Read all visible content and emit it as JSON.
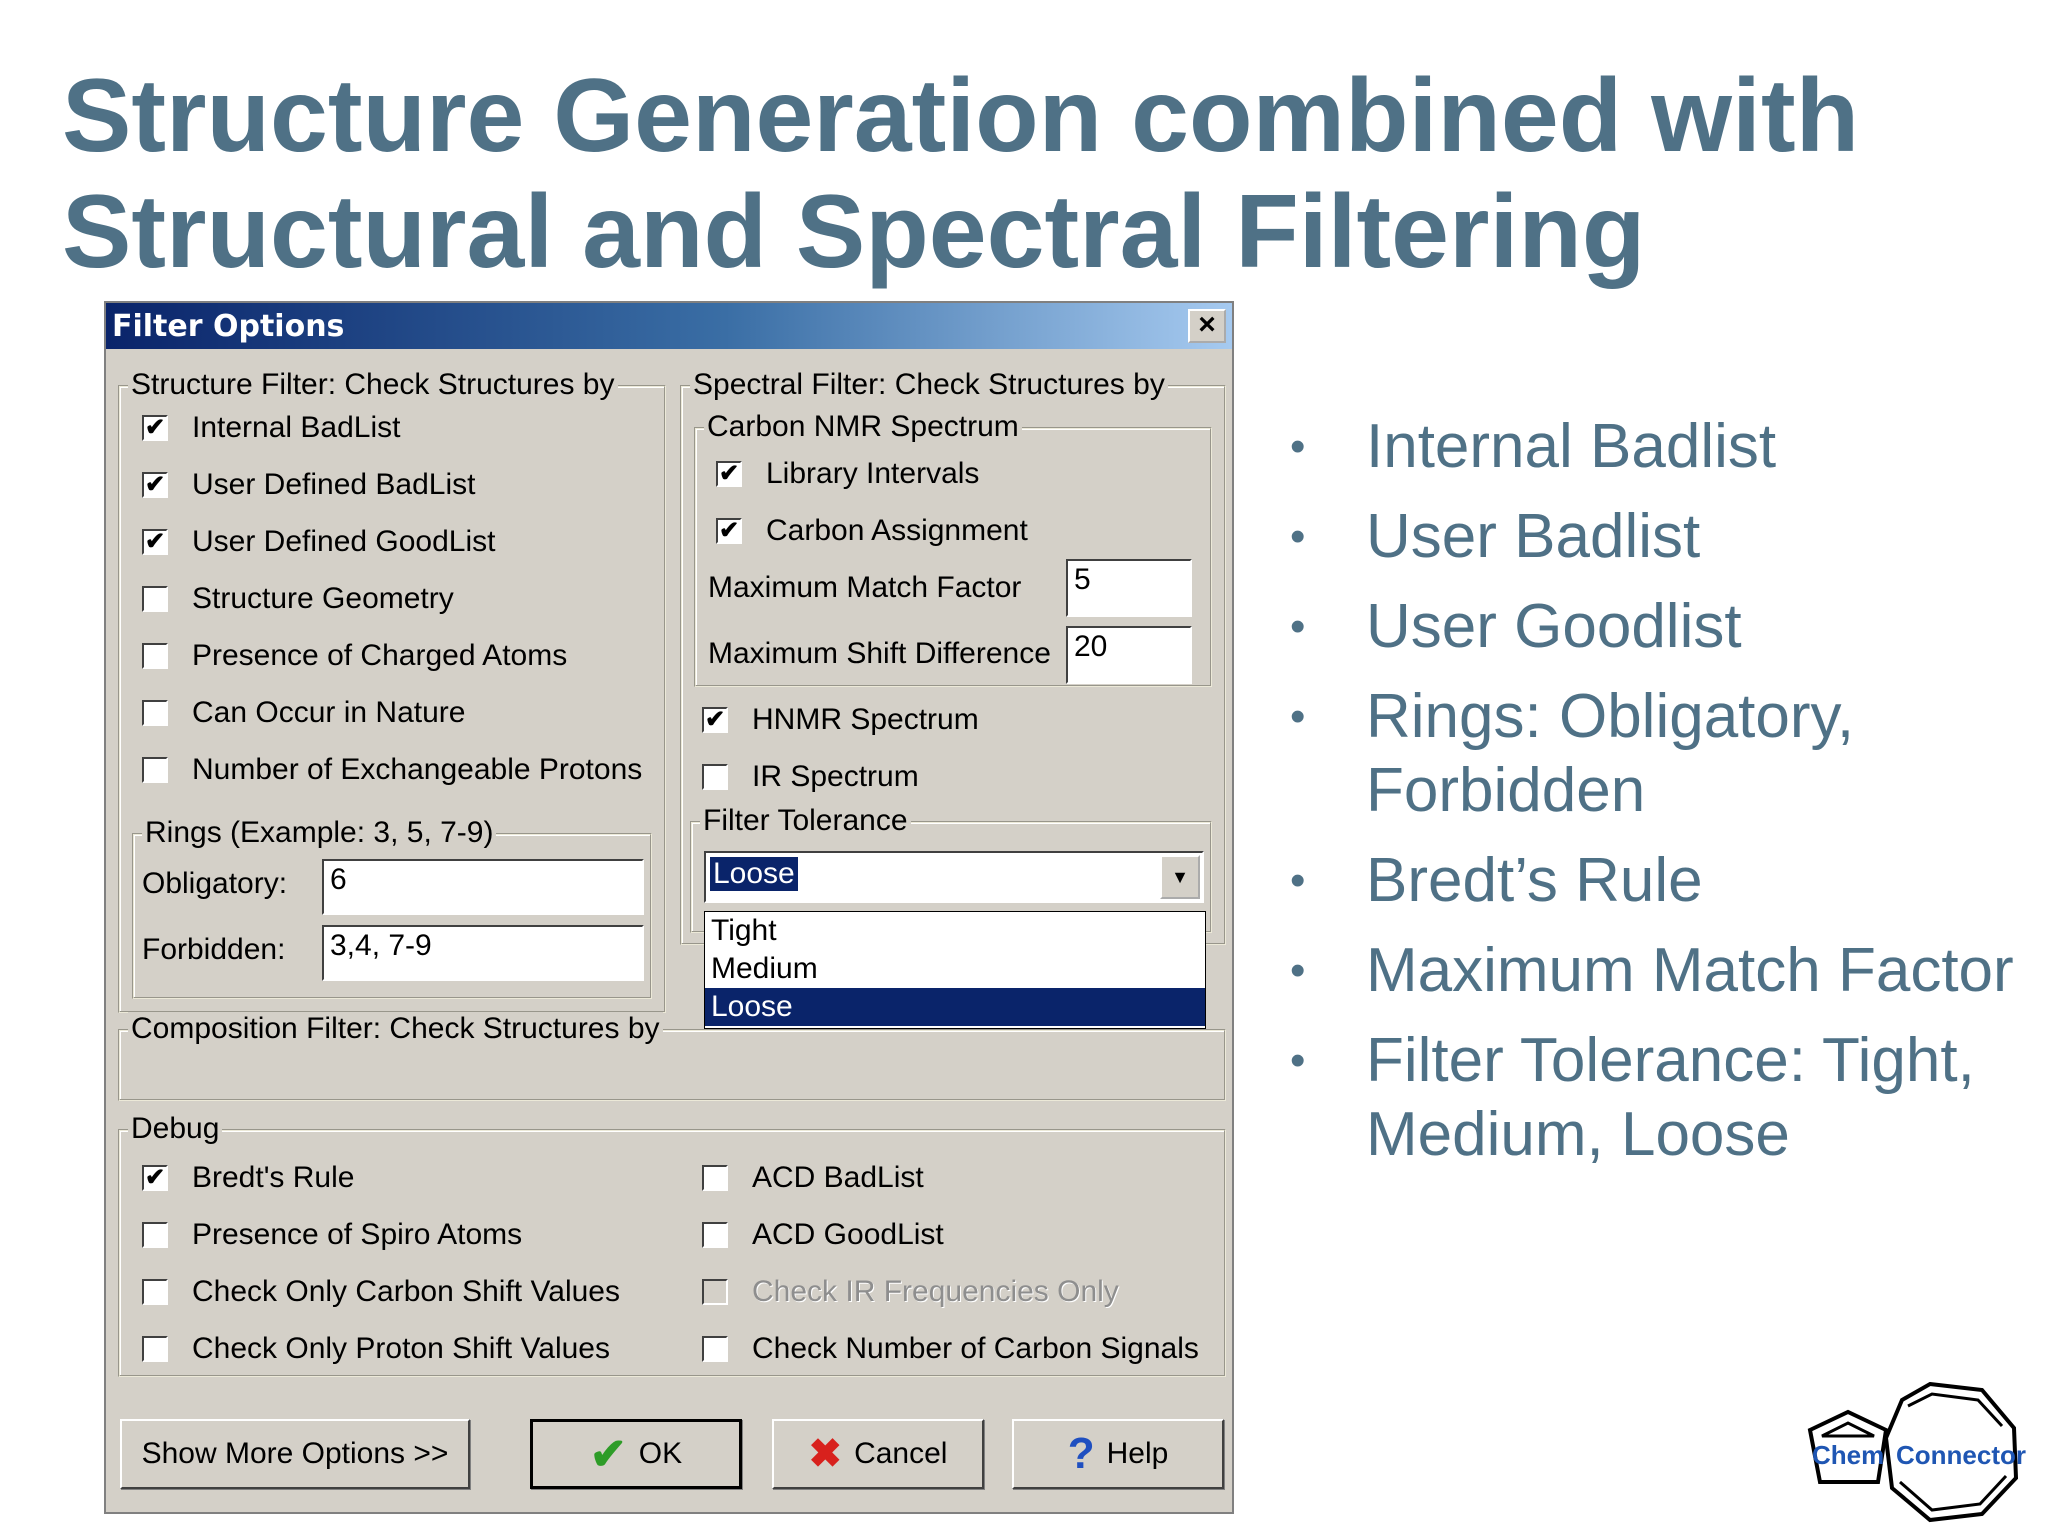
{
  "slide": {
    "title_line1": "Structure Generation combined with",
    "title_line2": "Structural and Spectral Filtering"
  },
  "dialog": {
    "title": "Filter Options",
    "close_glyph": "×",
    "structure_filter": {
      "legend": "Structure Filter: Check Structures by",
      "items": [
        {
          "label": "Internal BadList",
          "checked": true
        },
        {
          "label": "User Defined BadList",
          "checked": true
        },
        {
          "label": "User Defined GoodList",
          "checked": true
        },
        {
          "label": "Structure Geometry",
          "checked": false
        },
        {
          "label": "Presence of Charged Atoms",
          "checked": false
        },
        {
          "label": "Can Occur in Nature",
          "checked": false
        },
        {
          "label": "Number of Exchangeable Protons",
          "checked": false
        }
      ],
      "rings": {
        "legend": "Rings (Example: 3, 5, 7-9)",
        "obligatory_label": "Obligatory:",
        "obligatory_value": "6",
        "forbidden_label": "Forbidden:",
        "forbidden_value": "3,4, 7-9"
      }
    },
    "spectral_filter": {
      "legend": "Spectral Filter: Check Structures by",
      "carbon": {
        "legend": "Carbon NMR Spectrum",
        "library_intervals": {
          "label": "Library Intervals",
          "checked": true
        },
        "carbon_assignment": {
          "label": "Carbon  Assignment",
          "checked": true
        },
        "max_match_label": "Maximum Match Factor",
        "max_match_value": "5",
        "max_shift_label": "Maximum Shift Difference",
        "max_shift_value": "20"
      },
      "hnmr": {
        "label": "HNMR Spectrum",
        "checked": true
      },
      "ir": {
        "label": "IR Spectrum",
        "checked": false
      },
      "tolerance": {
        "legend": "Filter Tolerance",
        "selected": "Loose",
        "options": [
          "Tight",
          "Medium",
          "Loose"
        ]
      }
    },
    "composition_filter": {
      "legend": "Composition Filter: Check Structures by"
    },
    "debug": {
      "legend": "Debug",
      "left": [
        {
          "label": "Bredt's Rule",
          "checked": true,
          "disabled": false
        },
        {
          "label": "Presence of Spiro Atoms",
          "checked": false,
          "disabled": false
        },
        {
          "label": "Check Only Carbon Shift Values",
          "checked": false,
          "disabled": false
        },
        {
          "label": "Check Only Proton Shift Values",
          "checked": false,
          "disabled": false
        }
      ],
      "right": [
        {
          "label": "ACD BadList",
          "checked": false,
          "disabled": false
        },
        {
          "label": "ACD GoodList",
          "checked": false,
          "disabled": false
        },
        {
          "label": "Check IR Frequencies Only",
          "checked": false,
          "disabled": true
        },
        {
          "label": "Check Number of Carbon Signals",
          "checked": false,
          "disabled": false
        }
      ]
    },
    "buttons": {
      "more": "Show More Options >>",
      "ok": "OK",
      "cancel": "Cancel",
      "help": "Help",
      "ok_icon": "✔",
      "cancel_icon": "✖",
      "help_icon": "?"
    }
  },
  "bullets": {
    "glyph": "•",
    "items": [
      "Internal Badlist",
      "User Badlist",
      "User Goodlist",
      "Rings: Obligatory, Forbidden",
      "Bredt’s Rule",
      "Maximum Match Factor",
      "Filter Tolerance: Tight, Medium, Loose"
    ]
  },
  "logo": {
    "word1": "Chem",
    "word2": "Connector"
  },
  "colors": {
    "title": "#4f7186",
    "dialog_bg": "#d4d0c8",
    "selection": "#0a246a",
    "logo_blue": "#1f56b3"
  }
}
